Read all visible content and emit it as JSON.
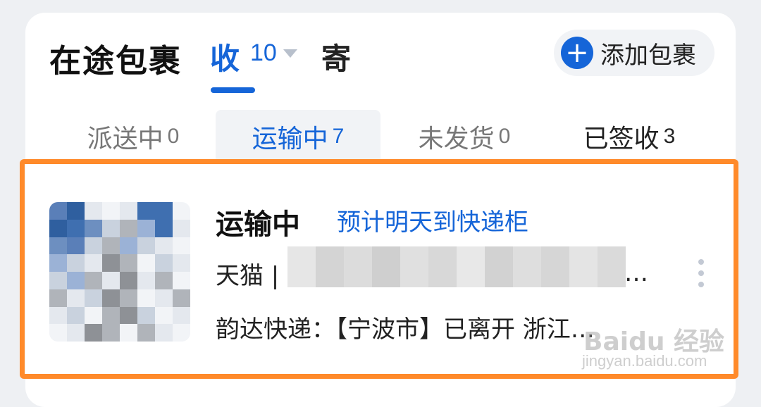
{
  "header": {
    "title": "在途包裹",
    "tabs": {
      "receive_label": "收",
      "receive_count": "10",
      "send_label": "寄"
    },
    "add_button_label": "添加包裹"
  },
  "subtabs": [
    {
      "label": "派送中",
      "count": "0"
    },
    {
      "label": "运输中",
      "count": "7"
    },
    {
      "label": "未发货",
      "count": "0"
    },
    {
      "label": "已签收",
      "count": "3"
    }
  ],
  "package": {
    "status": "运输中",
    "eta": "预计明天到快递柜",
    "shop": "天猫 | ",
    "shop_ellipsis": "…",
    "tracking": "韵达快递：【宁波市】已离开 浙江…"
  },
  "watermark": {
    "text": "Baidu 经验",
    "sub": "jingyan.baidu.com"
  },
  "colors": {
    "accent": "#1565d8",
    "highlight": "#ff8a2a"
  },
  "icons": {
    "add": "plus-circle-icon",
    "more": "more-vertical-icon",
    "dropdown": "caret-down-icon"
  }
}
